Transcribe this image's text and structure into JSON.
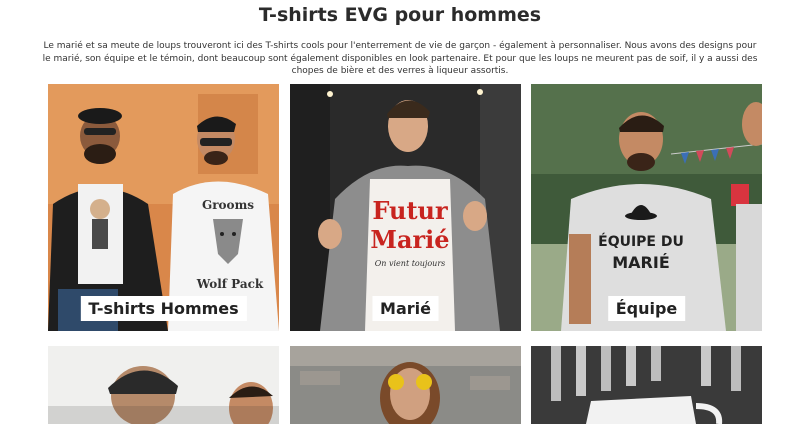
{
  "page": {
    "title": "T-shirts EVG pour hommes",
    "intro": "Le marié et sa meute de loups trouveront ici des T-shirts cools pour l'enterrement de vie de garçon - également à personnaliser. Nous avons des designs pour le marié, son équipe et le témoin, dont beaucoup sont également disponibles en look partenaire. Et pour que les loups ne meurent pas de soif, il y a aussi des chopes de bière et des verres à liqueur assortis."
  },
  "tiles": [
    {
      "label": "T-shirts Hommes",
      "image": "two-men-wolf-pack-tshirts-photo",
      "shirt_text": [
        "Grooms",
        "Wolf Pack"
      ]
    },
    {
      "label": "Marié",
      "image": "groom-futur-marie-tshirt-photo",
      "shirt_text": [
        "Futur",
        "Marié",
        "On vient toujours"
      ]
    },
    {
      "label": "Équipe",
      "image": "man-equipe-du-marie-tshirt-photo",
      "shirt_text": [
        "ÉQUIPE DU",
        "MARIÉ"
      ]
    },
    {
      "label": "",
      "image": "men-in-beanies-photo"
    },
    {
      "label": "",
      "image": "man-yellow-sunglasses-photo"
    },
    {
      "label": "",
      "image": "beer-taps-mug-photo"
    }
  ],
  "colors": {
    "tile1_bg": "#d9874a",
    "tile2_bg": "#2a2a2a",
    "tile3_bg": "#3f5a3a",
    "futur_marie_red": "#c8241f"
  }
}
